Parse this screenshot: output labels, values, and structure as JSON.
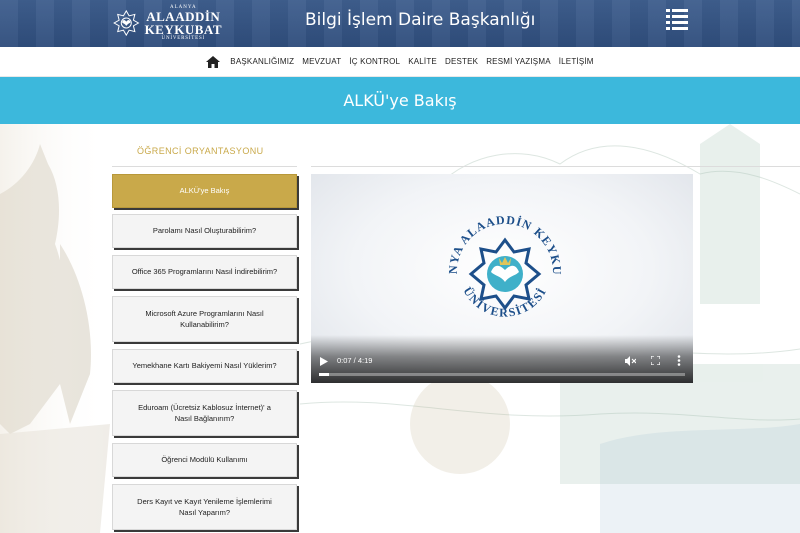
{
  "header": {
    "logo": {
      "line1": "ALANYA",
      "line2": "ALAADDİN",
      "line3": "KEYKUBAT",
      "line4": "ÜNİVERSİTESİ"
    },
    "title": "Bilgi İşlem Daire Başkanlığı",
    "menu_icon": "hamburger-list-icon",
    "color": "#36568a"
  },
  "nav": {
    "home_icon": "home-icon",
    "items": [
      "BAŞKANLIĞIMIZ",
      "MEVZUAT",
      "İÇ KONTROL",
      "KALİTE",
      "DESTEK",
      "RESMİ YAZIŞMA",
      "İLETİŞİM"
    ]
  },
  "banner": {
    "title": "ALKÜ'ye Bakış",
    "color": "#3cb8dc"
  },
  "sidebar": {
    "section_title": "ÖĞRENCİ ORYANTASYONU",
    "accent": "#c9a94a",
    "items": [
      {
        "label": "ALKÜ'ye Bakış",
        "active": true
      },
      {
        "label": "Parolamı Nasıl Oluşturabilirim?"
      },
      {
        "label": "Office 365 Programlarını Nasıl İndirebilirim?"
      },
      {
        "label": "Microsoft Azure Programlarını Nasıl Kullanabilirim?"
      },
      {
        "label": "Yemekhane Kartı Bakiyemi Nasıl Yüklerim?"
      },
      {
        "label": "Eduroam (Ücretsiz Kablosuz İnternet)' a Nasıl Bağlanırım?"
      },
      {
        "label": "Öğrenci Modülü Kullanımı"
      },
      {
        "label": "Ders Kayıt ve Kayıt Yenileme İşlemlerimi Nasıl Yaparım?"
      }
    ]
  },
  "video": {
    "logo_text_top": "ALANYA ALAADDİN KEYKUBAT",
    "logo_text_bottom": "ÜNİVERSİTESİ",
    "time": "0:07 / 4:19",
    "progress": 0.027,
    "controls": [
      "play-icon",
      "mute-icon",
      "fullscreen-icon",
      "more-options-icon"
    ]
  }
}
